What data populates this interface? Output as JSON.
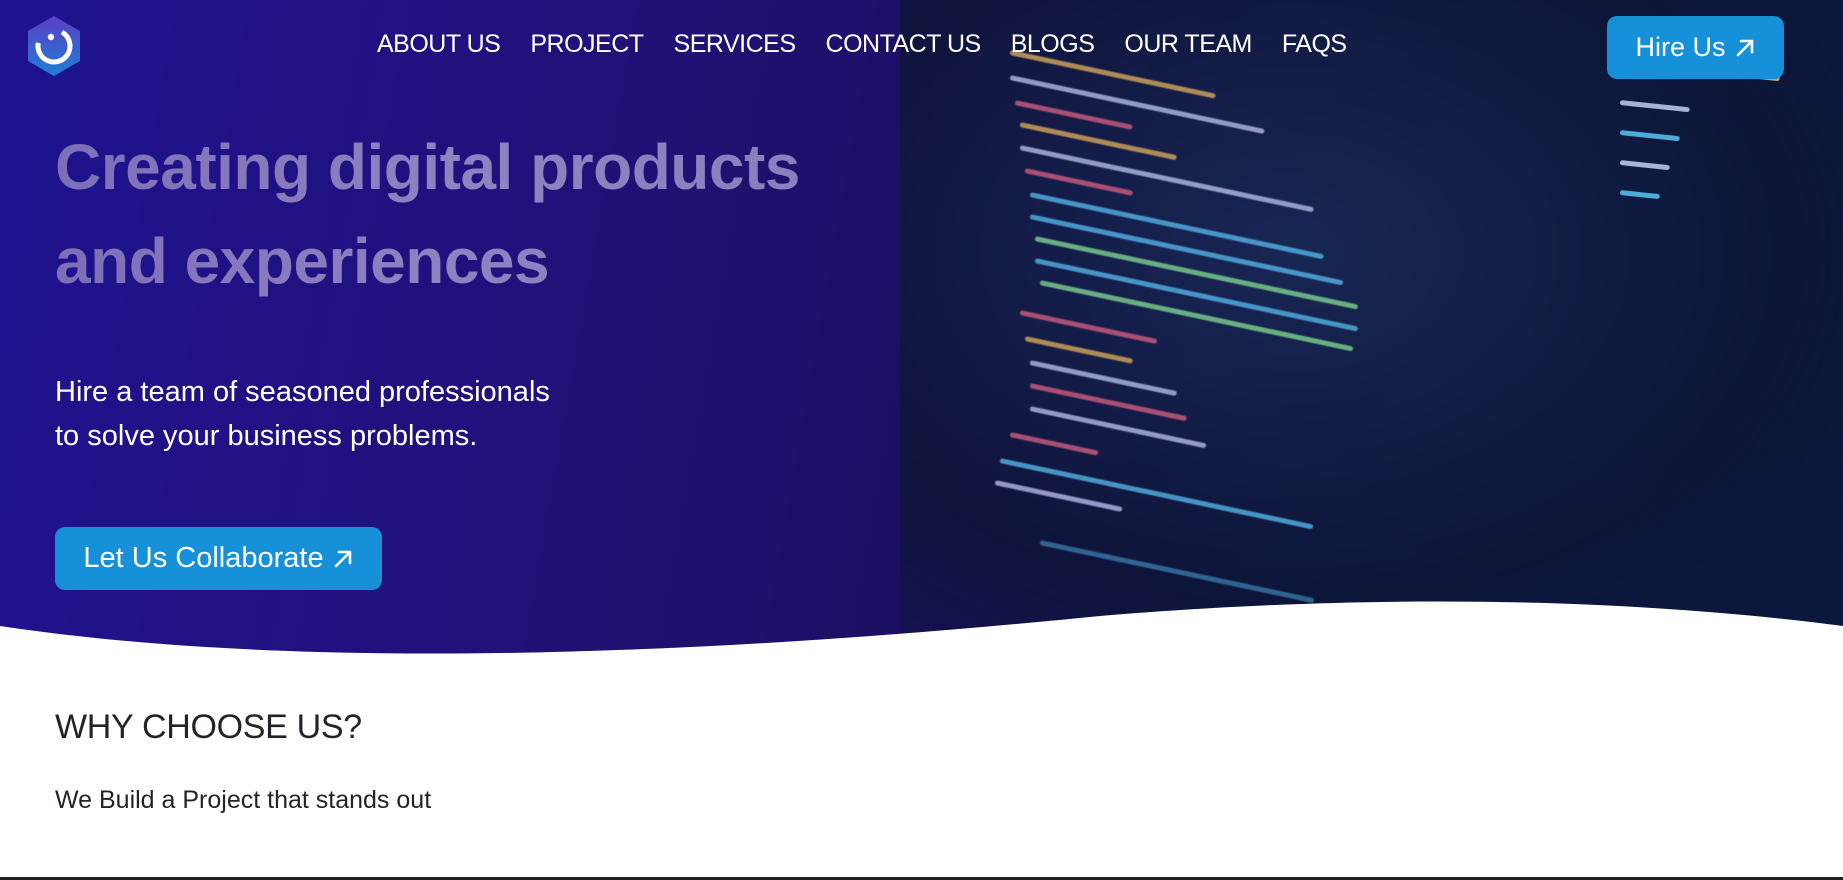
{
  "nav": {
    "logo_icon": "smiley-hexagon-logo",
    "links": [
      {
        "label": "ABOUT US"
      },
      {
        "label": "PROJECT"
      },
      {
        "label": "SERVICES"
      },
      {
        "label": "CONTACT US"
      },
      {
        "label": "BLOGS"
      },
      {
        "label": "OUR TEAM"
      },
      {
        "label": "FAQS"
      }
    ],
    "hire_label": "Hire Us",
    "hire_icon": "arrow-up-right-icon"
  },
  "hero": {
    "title_line1": "Creating digital products",
    "title_line2": "and experiences",
    "subtitle_line1": "Hire a team of seasoned professionals",
    "subtitle_line2": "to solve your business problems.",
    "cta_label": "Let Us Collaborate",
    "cta_icon": "arrow-up-right-icon"
  },
  "why": {
    "title": "WHY CHOOSE US?",
    "subtitle": "We Build a Project that stands out"
  },
  "colors": {
    "accent": "#1690d8",
    "hero_dark": "#1e1290",
    "title_tint": "#8a7fbd"
  }
}
